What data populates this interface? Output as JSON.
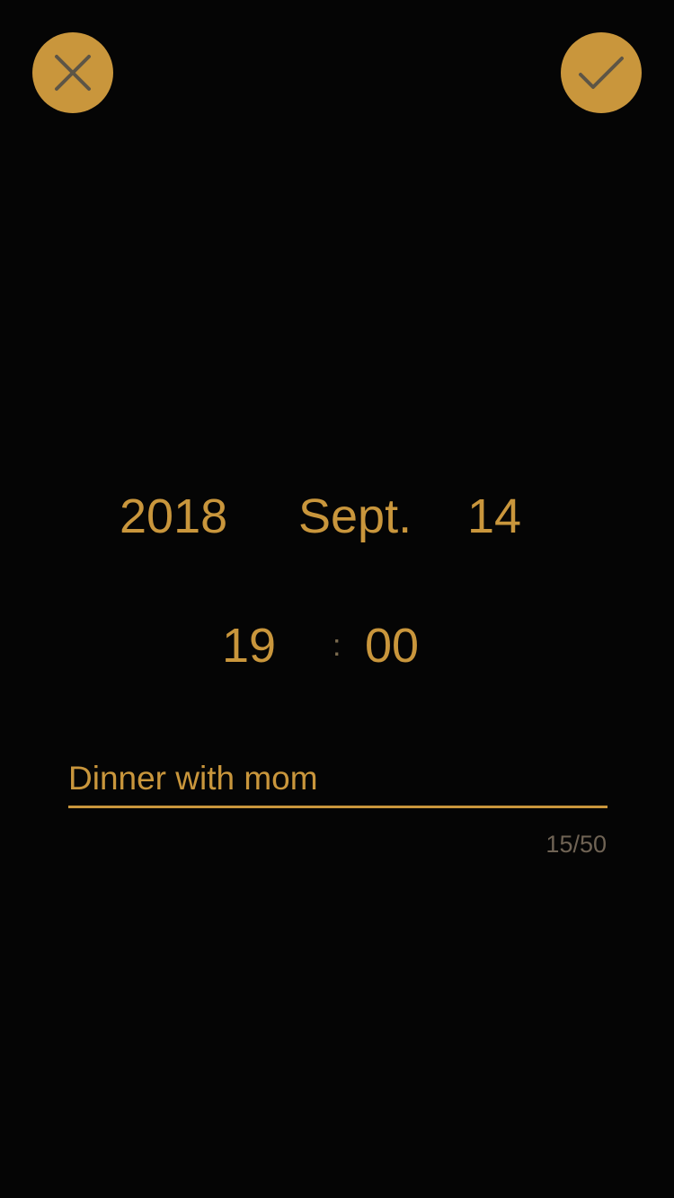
{
  "actions": {
    "close_icon": "close-icon",
    "confirm_icon": "check-icon",
    "accent_color": "#c9963c",
    "icon_color": "#5d5546"
  },
  "date": {
    "year": "2018",
    "month": "Sept.",
    "day": "14"
  },
  "time": {
    "hour": "19",
    "separator": ":",
    "minute": "00"
  },
  "title": {
    "value": "Dinner with mom",
    "counter": "15/50"
  }
}
